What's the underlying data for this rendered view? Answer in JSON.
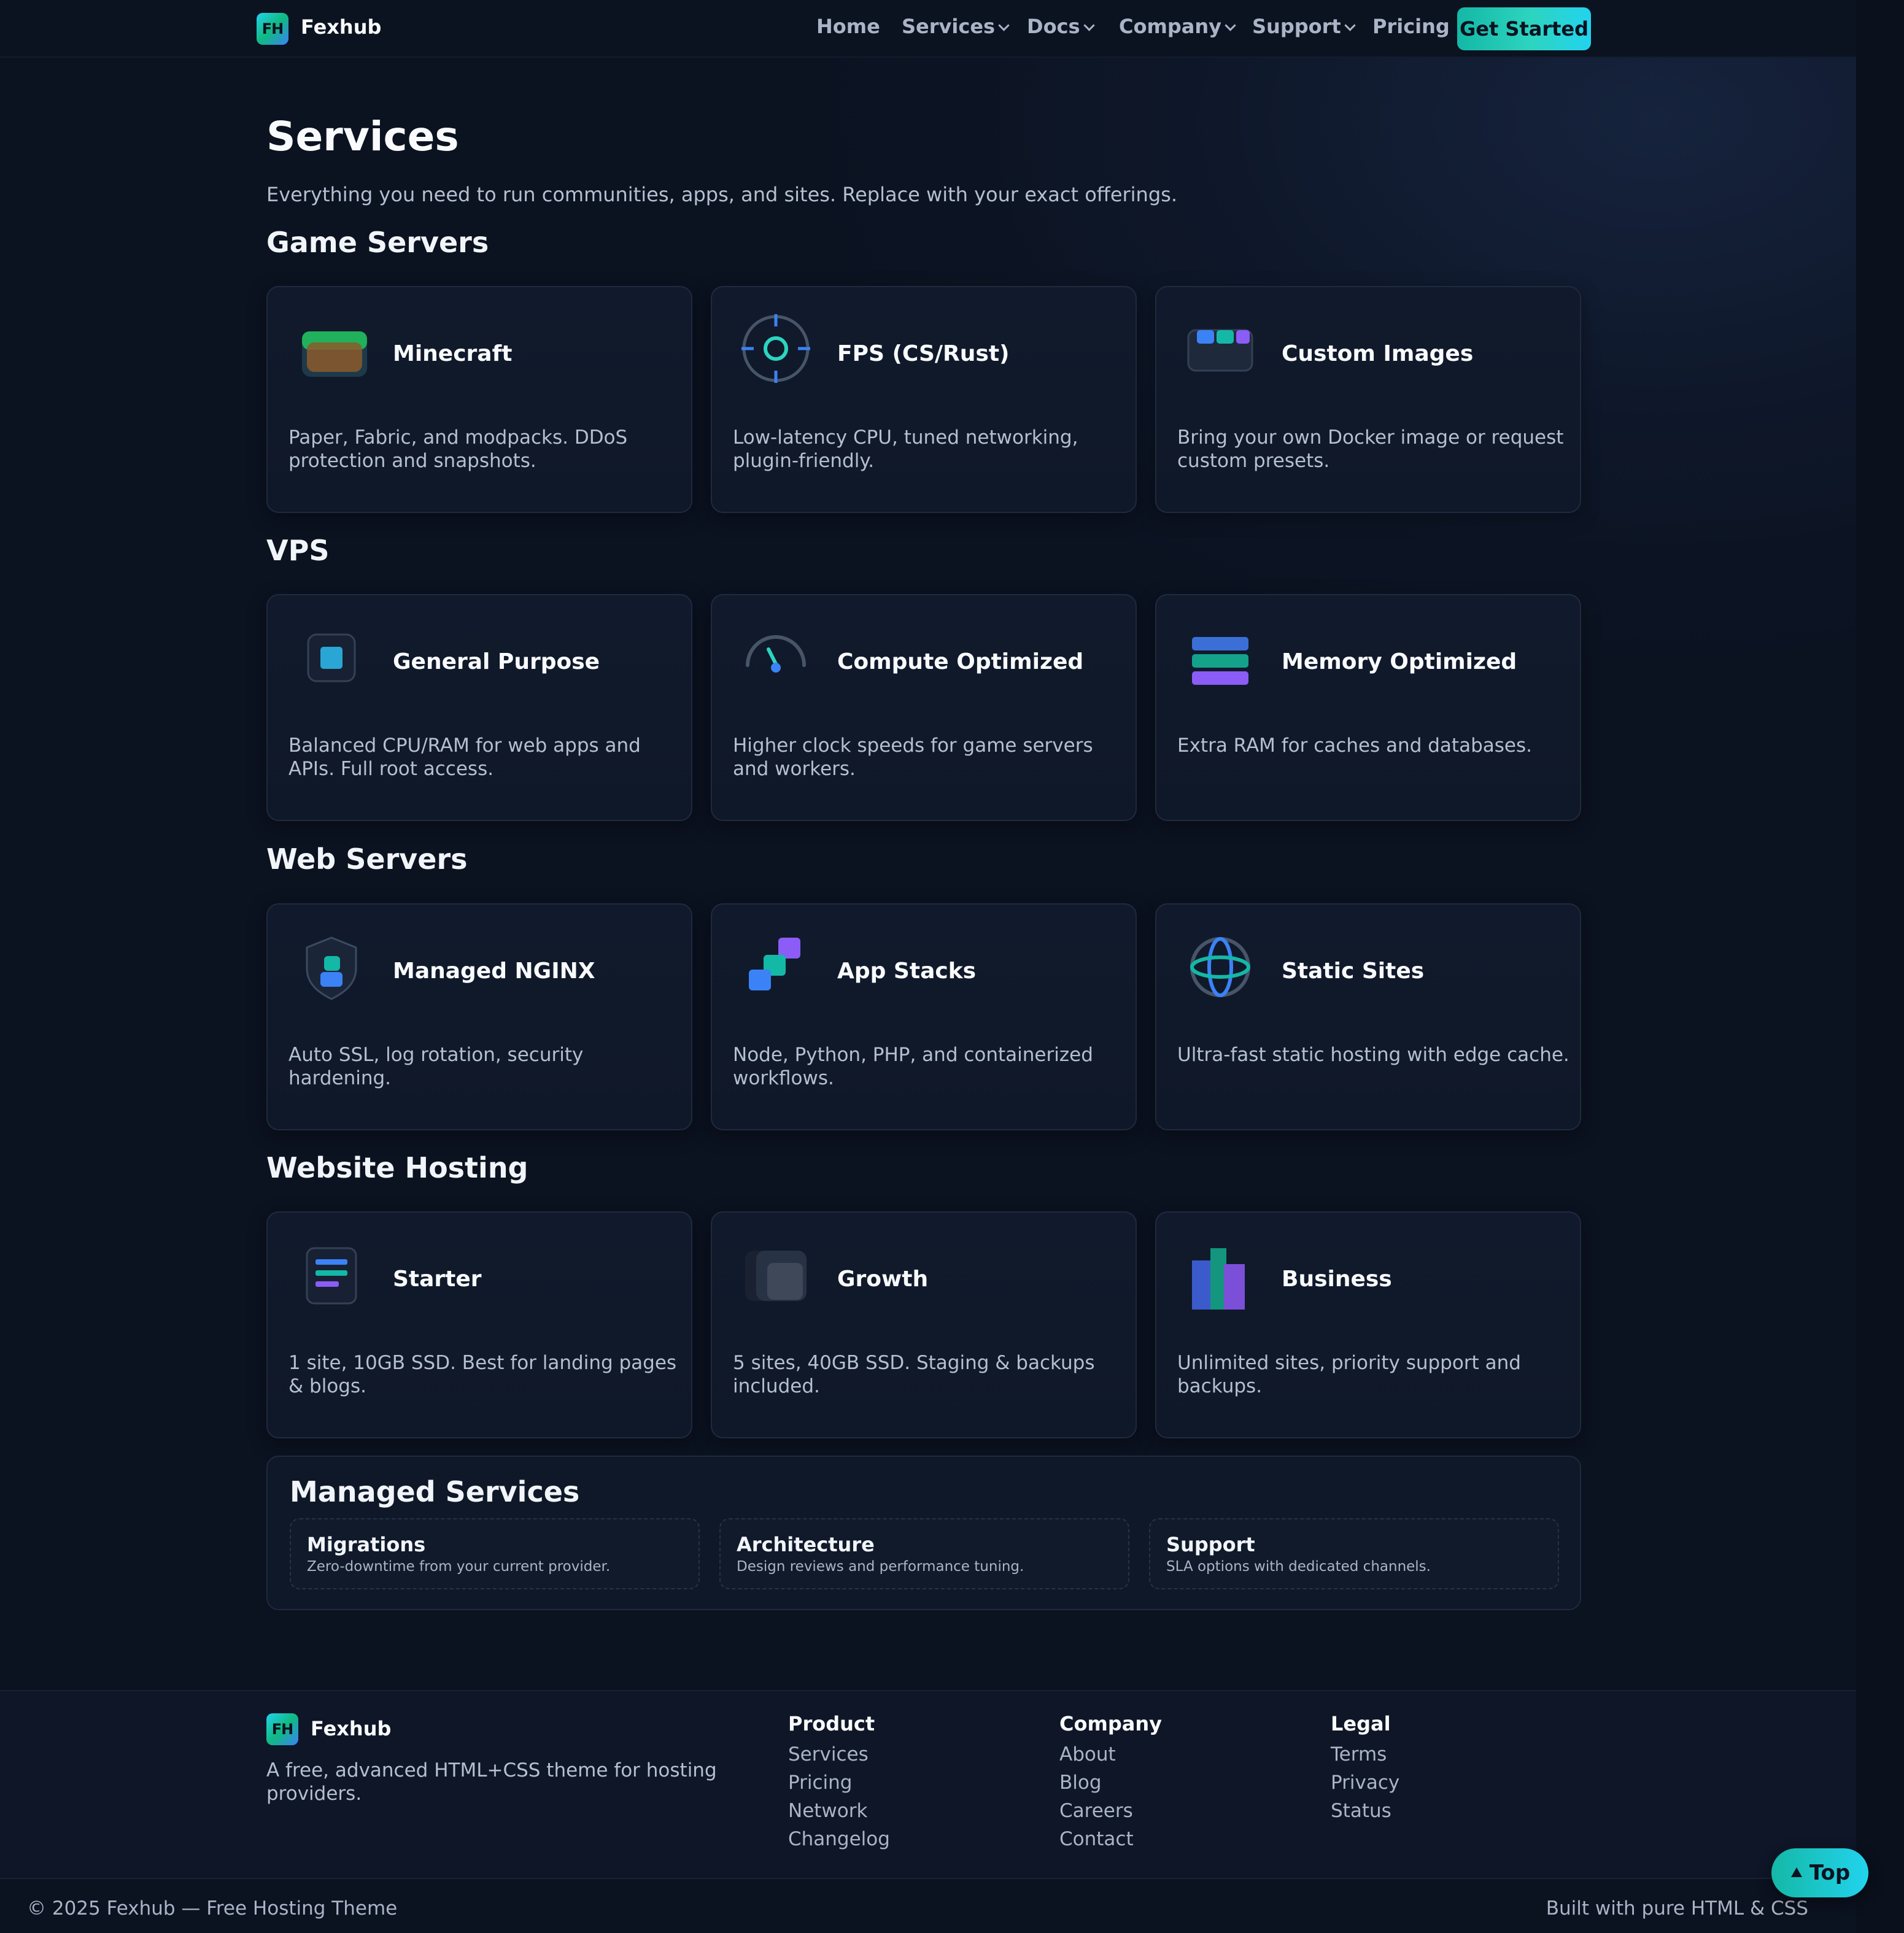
{
  "brand": {
    "mark": "FH",
    "name": "Fexhub"
  },
  "nav": {
    "links": [
      "Home",
      "Services",
      "Docs",
      "Company",
      "Support",
      "Pricing"
    ],
    "cta": "Get Started"
  },
  "page": {
    "title": "Services",
    "subtitle": "Everything you need to run communities, apps, and sites. Replace with your exact offerings."
  },
  "sections": [
    {
      "title": "Game Servers",
      "cards": [
        {
          "icon": "minecraft-block-icon",
          "title": "Minecraft",
          "desc": "Paper, Fabric, and modpacks. DDoS protection and snapshots."
        },
        {
          "icon": "crosshair-icon",
          "title": "FPS (CS/Rust)",
          "desc": "Low-latency CPU, tuned networking, plugin-friendly."
        },
        {
          "icon": "container-images-icon",
          "title": "Custom Images",
          "desc": "Bring your own Docker image or request custom presets."
        }
      ]
    },
    {
      "title": "VPS",
      "cards": [
        {
          "icon": "chip-icon",
          "title": "General Purpose",
          "desc": "Balanced CPU/RAM for web apps and APIs. Full root access."
        },
        {
          "icon": "gauge-icon",
          "title": "Compute Optimized",
          "desc": "Higher clock speeds for game servers and workers."
        },
        {
          "icon": "memory-stack-icon",
          "title": "Memory Optimized",
          "desc": "Extra RAM for caches and databases."
        }
      ]
    },
    {
      "title": "Web Servers",
      "cards": [
        {
          "icon": "shield-icon",
          "title": "Managed NGINX",
          "desc": "Auto SSL, log rotation, security hardening."
        },
        {
          "icon": "stacked-blocks-icon",
          "title": "App Stacks",
          "desc": "Node, Python, PHP, and containerized workflows."
        },
        {
          "icon": "globe-icon",
          "title": "Static Sites",
          "desc": "Ultra-fast static hosting with edge cache."
        }
      ]
    },
    {
      "title": "Website Hosting",
      "cards": [
        {
          "icon": "document-lines-icon",
          "title": "Starter",
          "desc": "1 site, 10GB SSD. Best for landing pages & blogs."
        },
        {
          "icon": "layered-squares-icon",
          "title": "Growth",
          "desc": "5 sites, 40GB SSD. Staging & backups included."
        },
        {
          "icon": "bar-chart-icon",
          "title": "Business",
          "desc": "Unlimited sites, priority support and backups."
        }
      ]
    }
  ],
  "managed": {
    "title": "Managed Services",
    "items": [
      {
        "title": "Migrations",
        "desc": "Zero-downtime from your current provider."
      },
      {
        "title": "Architecture",
        "desc": "Design reviews and performance tuning."
      },
      {
        "title": "Support",
        "desc": "SLA options with dedicated channels."
      }
    ]
  },
  "footer": {
    "tagline": "A free, advanced HTML+CSS theme for hosting providers.",
    "columns": [
      {
        "title": "Product",
        "links": [
          "Services",
          "Pricing",
          "Network",
          "Changelog"
        ]
      },
      {
        "title": "Company",
        "links": [
          "About",
          "Blog",
          "Careers",
          "Contact"
        ]
      },
      {
        "title": "Legal",
        "links": [
          "Terms",
          "Privacy",
          "Status"
        ]
      }
    ],
    "copyright": "© 2025 Fexhub — Free Hosting Theme",
    "built_with": "Built with pure HTML & CSS"
  },
  "top_button": {
    "icon": "arrow-up-icon",
    "label": "Top"
  },
  "colors": {
    "accent": "#2dd4bf",
    "blue": "#3b82f6",
    "purple": "#8b5cf6",
    "background": "#0b1220"
  }
}
